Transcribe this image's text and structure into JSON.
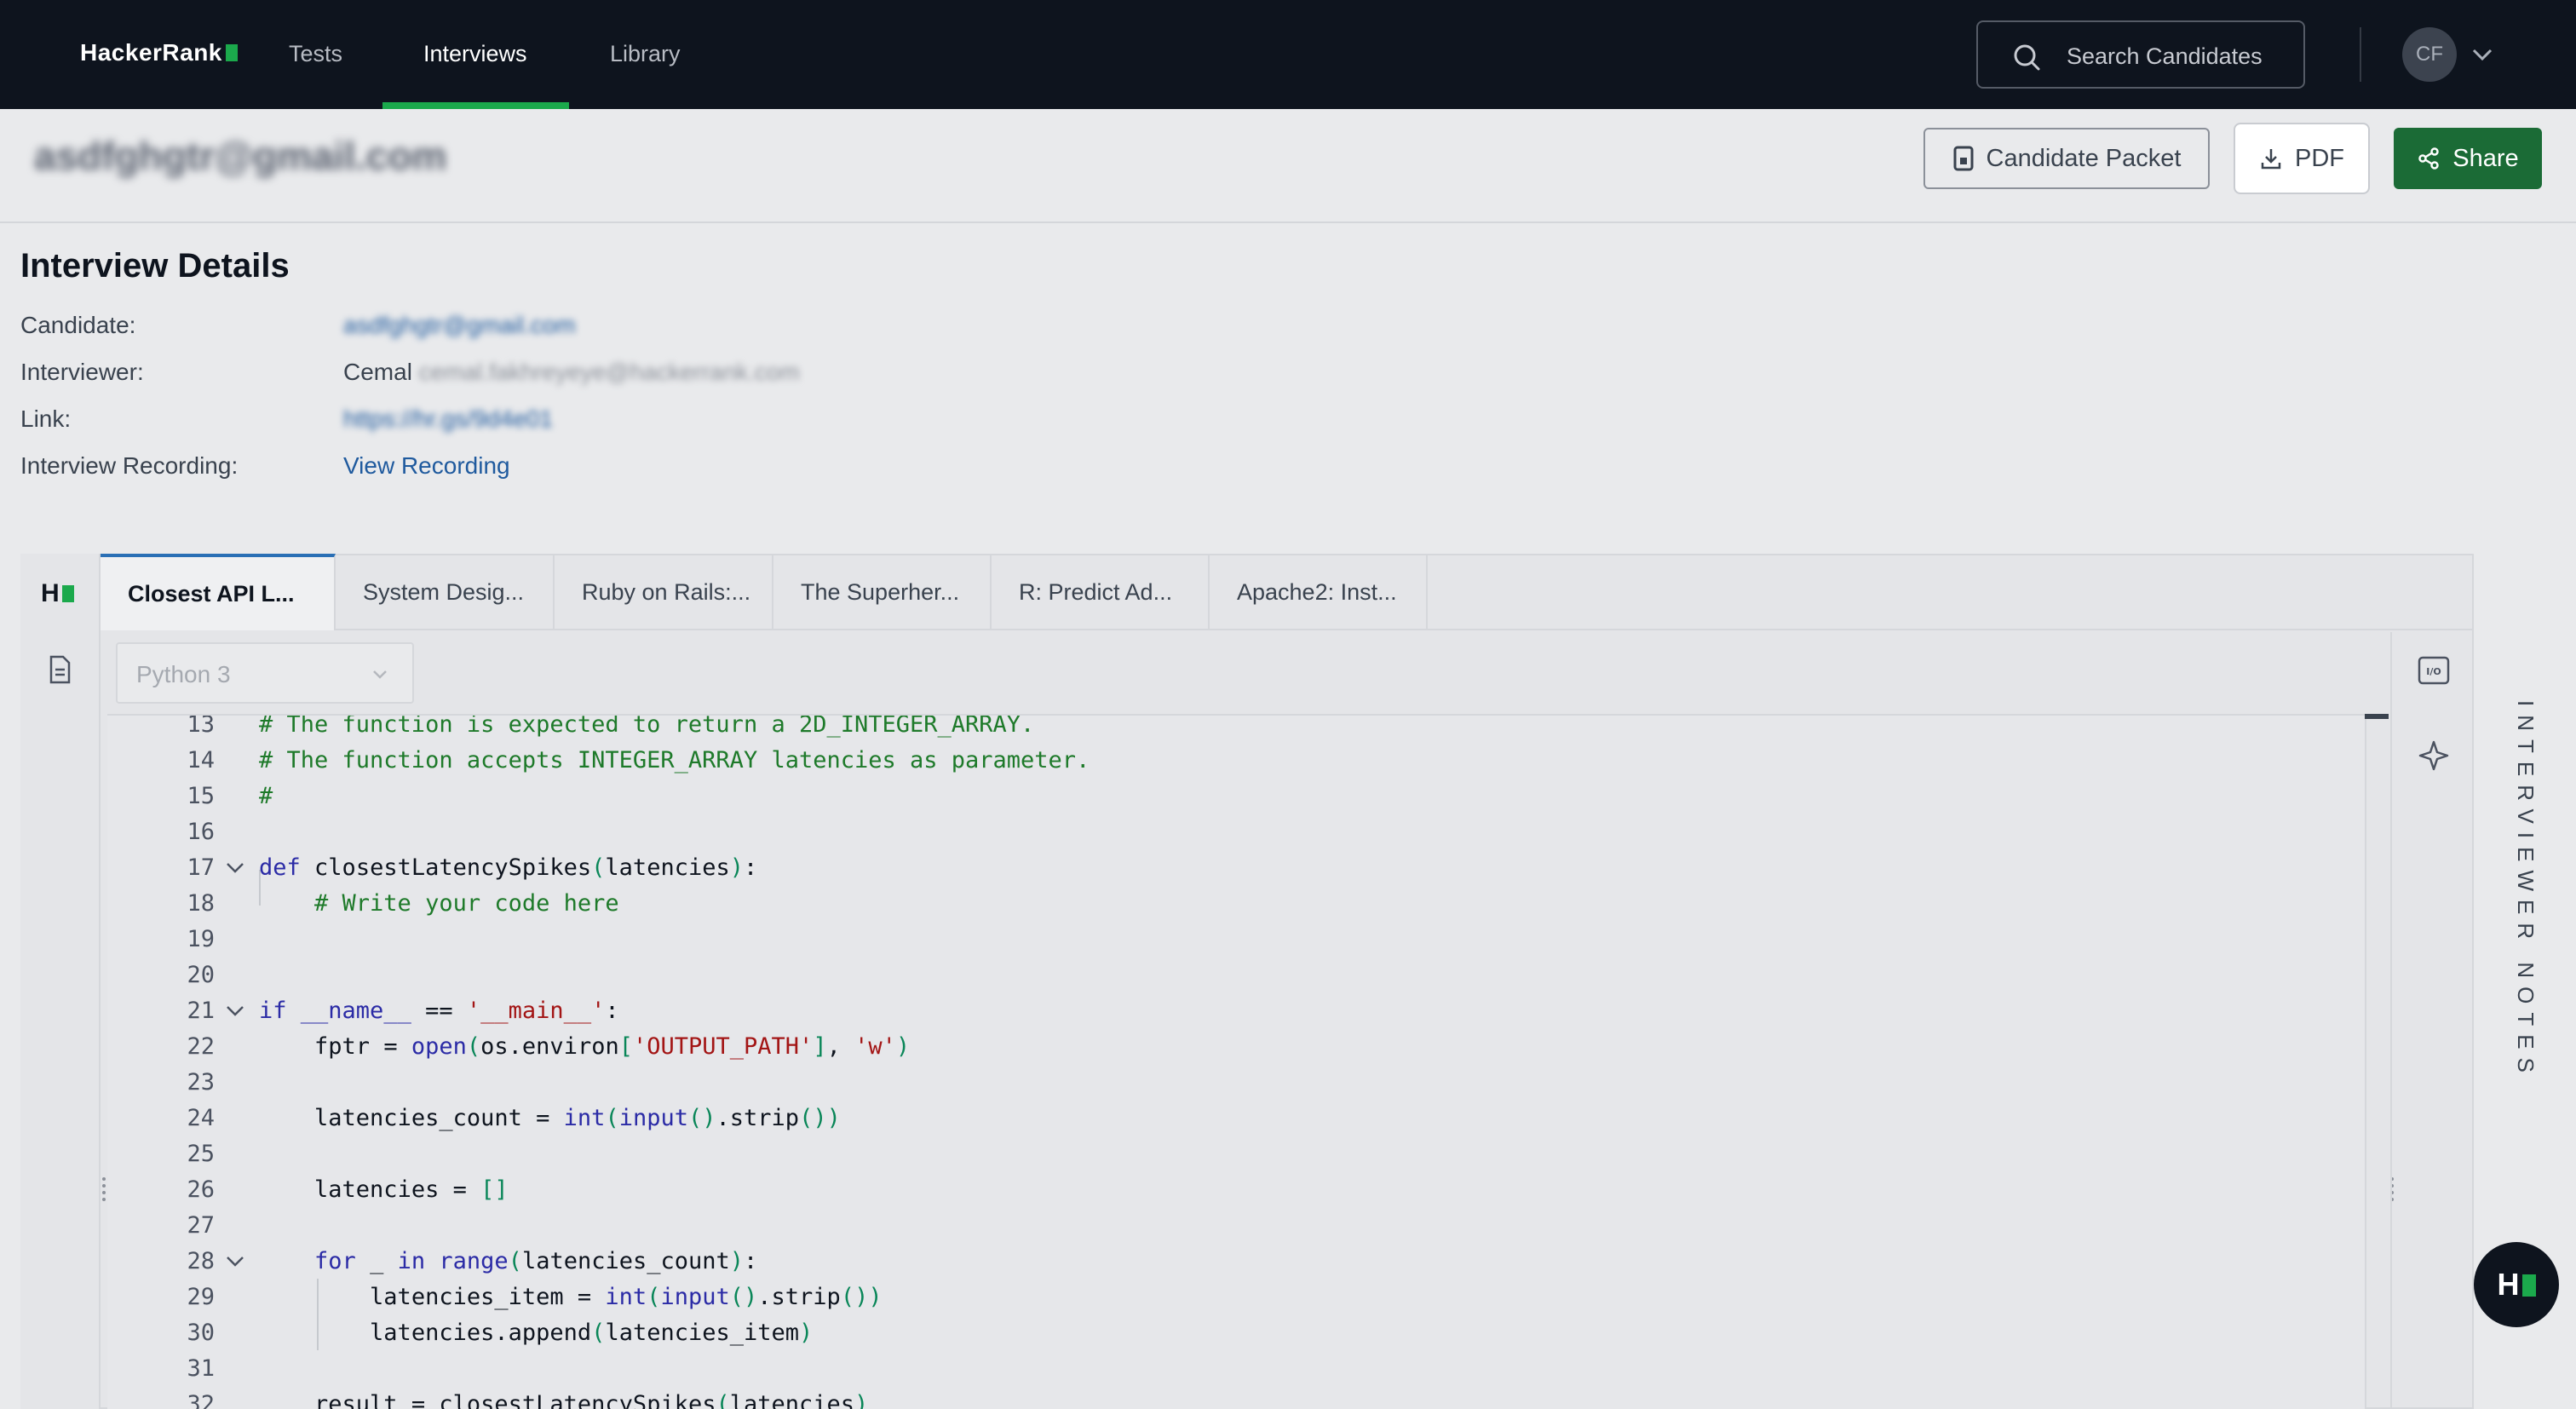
{
  "brand": {
    "name": "HackerRank"
  },
  "nav": {
    "links": [
      {
        "label": "Tests",
        "active": false
      },
      {
        "label": "Interviews",
        "active": true
      },
      {
        "label": "Library",
        "active": false
      }
    ],
    "search_placeholder": "Search Candidates",
    "avatar_initials": "CF"
  },
  "header": {
    "candidate_email": "asdfghgtr@gmail.com",
    "buttons": {
      "packet": "Candidate Packet",
      "pdf": "PDF",
      "share": "Share"
    }
  },
  "details": {
    "title": "Interview Details",
    "rows": [
      {
        "label": "Candidate:",
        "value": "asdfghgtr@gmail.com"
      },
      {
        "label": "Interviewer:",
        "value_prefix": "Cemal",
        "value": "cemal.fakhreyeye@hackerrank.com"
      },
      {
        "label": "Link:",
        "value": "https://hr.gs/9d4e01"
      },
      {
        "label": "Interview Recording:",
        "value": "View Recording"
      }
    ]
  },
  "editor": {
    "tabs": [
      {
        "label": "Closest API L...",
        "active": true
      },
      {
        "label": "System Desig...",
        "active": false
      },
      {
        "label": "Ruby on Rails:...",
        "active": false
      },
      {
        "label": "The Superher...",
        "active": false
      },
      {
        "label": "R: Predict Ad...",
        "active": false
      },
      {
        "label": "Apache2: Inst...",
        "active": false
      }
    ],
    "language": "Python 3",
    "notes_label": "INTERVIEWER NOTES",
    "code_lines": [
      {
        "n": "13",
        "text": "# The function is expected to return a 2D_INTEGER_ARRAY."
      },
      {
        "n": "14",
        "text": "# The function accepts INTEGER_ARRAY latencies as parameter."
      },
      {
        "n": "15",
        "text": "#"
      },
      {
        "n": "16",
        "text": ""
      },
      {
        "n": "17",
        "text": "def closestLatencySpikes(latencies):"
      },
      {
        "n": "18",
        "text": "    # Write your code here"
      },
      {
        "n": "19",
        "text": ""
      },
      {
        "n": "20",
        "text": ""
      },
      {
        "n": "21",
        "text": "if __name__ == '__main__':"
      },
      {
        "n": "22",
        "text": "    fptr = open(os.environ['OUTPUT_PATH'], 'w')"
      },
      {
        "n": "23",
        "text": ""
      },
      {
        "n": "24",
        "text": "    latencies_count = int(input().strip())"
      },
      {
        "n": "25",
        "text": ""
      },
      {
        "n": "26",
        "text": "    latencies = []"
      },
      {
        "n": "27",
        "text": ""
      },
      {
        "n": "28",
        "text": "    for _ in range(latencies_count):"
      },
      {
        "n": "29",
        "text": "        latencies_item = int(input().strip())"
      },
      {
        "n": "30",
        "text": "        latencies.append(latencies_item)"
      },
      {
        "n": "31",
        "text": ""
      },
      {
        "n": "32",
        "text": "    result = closestLatencySpikes(latencies)"
      }
    ]
  }
}
